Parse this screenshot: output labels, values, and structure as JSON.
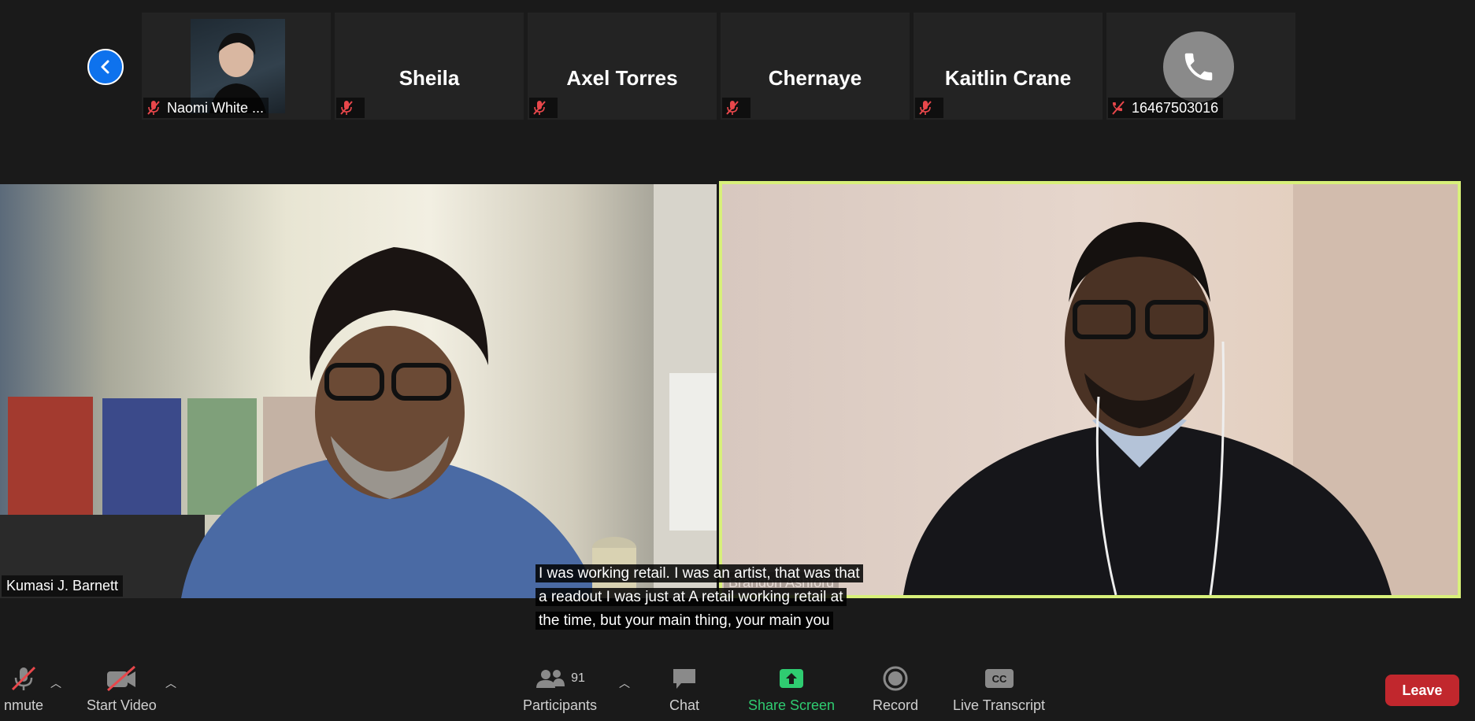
{
  "participants_strip": [
    {
      "name": "",
      "footer_label": "Naomi White ...",
      "has_photo": true
    },
    {
      "name": "Sheila",
      "footer_label": ""
    },
    {
      "name": "Axel Torres",
      "footer_label": ""
    },
    {
      "name": "Chernaye",
      "footer_label": ""
    },
    {
      "name": "Kaitlin Crane",
      "footer_label": ""
    },
    {
      "name": "",
      "footer_label": "16467503016",
      "is_phone": true
    }
  ],
  "videos": {
    "left_label": "Kumasi J. Barnett",
    "right_label": "Brandon Ashford",
    "active_speaker_border": "#d8f07a"
  },
  "caption": {
    "lines": [
      "I was working retail. I was an artist, that was that",
      "a readout I was just at A retail working retail at",
      "the time, but your main thing, your main you"
    ]
  },
  "toolbar": {
    "unmute_label": "nmute",
    "start_video_label": "Start Video",
    "participants_count": "91",
    "participants_label": "Participants",
    "chat_label": "Chat",
    "share_screen_label": "Share Screen",
    "record_label": "Record",
    "live_transcript_label": "Live Transcript",
    "leave_label": "Leave"
  },
  "colors": {
    "accent_blue": "#0e72ed",
    "share_green": "#2fcc71",
    "leave_red": "#c1272d",
    "muted_red": "#e8474b"
  }
}
